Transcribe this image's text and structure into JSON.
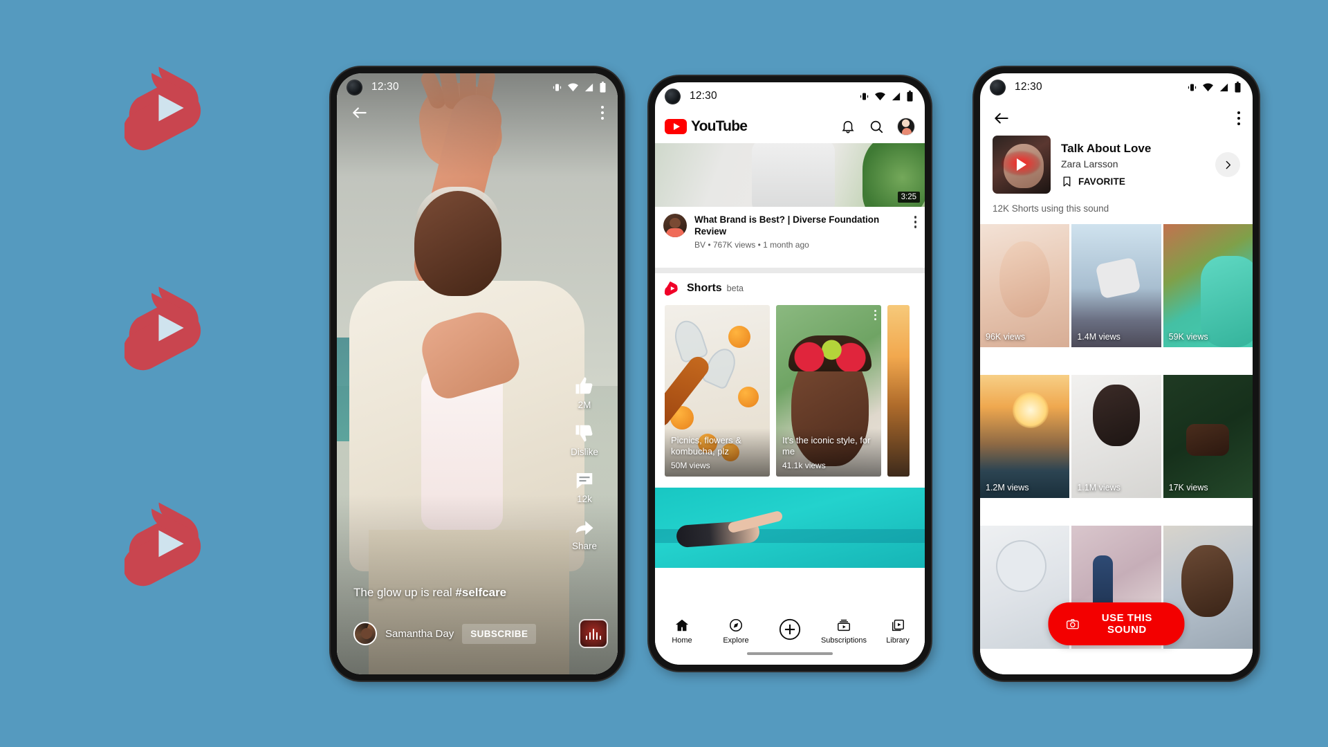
{
  "theme": {
    "background": "#559abf",
    "shorts_red": "#c9454f",
    "youtube_red": "#ff0000",
    "cta_red": "#f30000"
  },
  "background_logos": {
    "icon": "shorts-logo-icon",
    "count": 3
  },
  "phone1": {
    "name": "shorts-player",
    "status": {
      "time": "12:30",
      "icons": [
        "vibrate-icon",
        "wifi-icon",
        "signal-icon",
        "battery-icon"
      ]
    },
    "topbar": {
      "back": "back-arrow-icon",
      "more": "more-vertical-icon"
    },
    "actions": [
      {
        "icon": "thumbs-up-icon",
        "label": "2M"
      },
      {
        "icon": "thumbs-down-icon",
        "label": "Dislike"
      },
      {
        "icon": "comment-icon",
        "label": "12k"
      },
      {
        "icon": "share-icon",
        "label": "Share"
      }
    ],
    "caption_plain": "The glow up is real ",
    "caption_hashtag": "#selfcare",
    "channel": "Samantha Day",
    "subscribe_label": "SUBSCRIBE",
    "sound_chip": "sound-waveform-icon"
  },
  "phone2": {
    "name": "youtube-home-feed",
    "status": {
      "time": "12:30"
    },
    "header": {
      "logo_word": "YouTube",
      "icons": [
        "notifications-bell-icon",
        "search-icon",
        "account-avatar"
      ]
    },
    "video": {
      "duration": "3:25",
      "title": "What Brand is Best? | Diverse Foundation Review",
      "meta": "BV • 767K views • 1 month ago"
    },
    "shorts_shelf": {
      "title": "Shorts",
      "badge": "beta",
      "cards": [
        {
          "title": "Picnics, flowers & kombucha, plz",
          "views": "50M views"
        },
        {
          "title": "It's the iconic style, for me",
          "views": "41.1k views"
        }
      ]
    },
    "nav": [
      {
        "icon": "home-icon",
        "label": "Home"
      },
      {
        "icon": "explore-compass-icon",
        "label": "Explore"
      },
      {
        "icon": "create-plus-icon",
        "label": ""
      },
      {
        "icon": "subscriptions-icon",
        "label": "Subscriptions"
      },
      {
        "icon": "library-icon",
        "label": "Library"
      }
    ]
  },
  "phone3": {
    "name": "sound-detail-page",
    "status": {
      "time": "12:30"
    },
    "topbar": {
      "back": "back-arrow-icon",
      "more": "more-vertical-icon"
    },
    "sound": {
      "title": "Talk About Love",
      "artist": "Zara Larsson",
      "favorite_label": "FAVORITE",
      "favorite_icon": "bookmark-icon",
      "chevron": "chevron-right-icon",
      "thumb_play": "play-triangle-icon"
    },
    "count_text": "12K Shorts using this sound",
    "grid": [
      {
        "views": "96K views",
        "art": "art-skincare"
      },
      {
        "views": "1.4M views",
        "art": "art-skate"
      },
      {
        "views": "59K views",
        "art": "art-green"
      },
      {
        "views": "1.2M views",
        "art": "art-sunset"
      },
      {
        "views": "1.1M views",
        "art": "art-blanket"
      },
      {
        "views": "17K views",
        "art": "art-cake"
      },
      {
        "views": "",
        "art": "art-table"
      },
      {
        "views": "",
        "art": "art-dance"
      },
      {
        "views": "",
        "art": "art-sunglass"
      }
    ],
    "cta": {
      "label": "USE THIS SOUND",
      "icon": "camera-icon"
    }
  }
}
